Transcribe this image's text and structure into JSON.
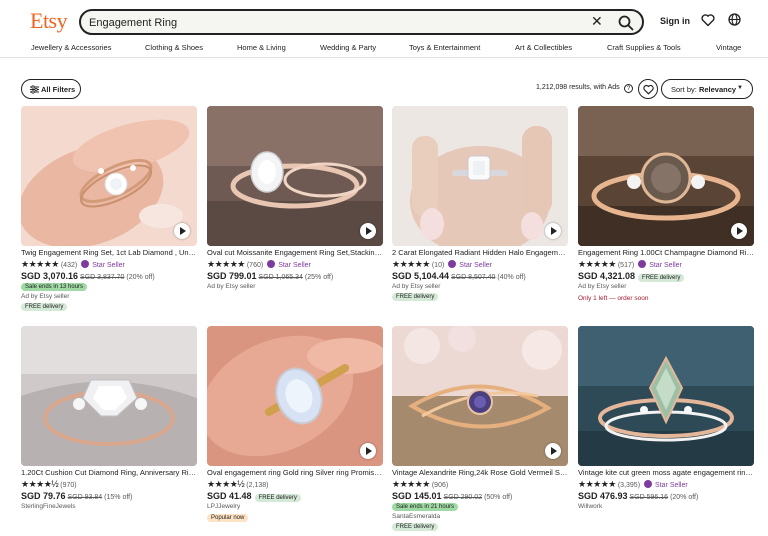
{
  "brand": {
    "logo": "Etsy",
    "accent": "#F1641E"
  },
  "search": {
    "value": "Engagement Ring",
    "clear_icon": "close-icon",
    "submit_icon": "search-icon"
  },
  "header": {
    "sign_in": "Sign in",
    "icons": [
      "heart-icon",
      "globe-icon"
    ]
  },
  "categories": [
    "Jewellery & Accessories",
    "Clothing & Shoes",
    "Home & Living",
    "Wedding & Party",
    "Toys & Entertainment",
    "Art & Collectibles",
    "Craft Supplies & Tools",
    "Vintage"
  ],
  "toolbar": {
    "filters_label": "All Filters",
    "results_text": "1,212,098 results, with Ads",
    "sort_prefix": "Sort by: ",
    "sort_value": "Relevancy"
  },
  "products": [
    {
      "title": "Twig Engagement Ring Set, 1ct Lab Diamond , Uniqu...",
      "stars": "★★★★★",
      "reviews": "(432)",
      "star_seller": "Star Seller",
      "price": "SGD 3,070.16",
      "original": "SGD 3,837.70",
      "discount": "(20% off)",
      "sale_badge": "Sale ends in 13 hours",
      "ad_line": "Ad by Etsy seller",
      "delivery": "FREE delivery",
      "video": true
    },
    {
      "title": "Oval cut Moissanite Engagement Ring Set,Stacking Ri...",
      "stars": "★★★★★",
      "reviews": "(760)",
      "star_seller": "Star Seller",
      "price": "SGD 799.01",
      "original": "SGD 1,065.34",
      "discount": "(25% off)",
      "ad_line": "Ad by Etsy seller",
      "video": true
    },
    {
      "title": "2 Carat Elongated Radiant Hidden Halo Engagement...",
      "stars": "★★★★★",
      "reviews": "(10)",
      "star_seller": "Star Seller",
      "price": "SGD 5,104.44",
      "original": "SGD 8,507.40",
      "discount": "(40% off)",
      "ad_line": "Ad by Etsy seller",
      "delivery": "FREE delivery",
      "video": true
    },
    {
      "title": "Engagement Ring 1.00Ct Champagne Diamond Ring,...",
      "stars": "★★★★★",
      "reviews": "(517)",
      "star_seller": "Star Seller",
      "price": "SGD 4,321.08",
      "price_badge": "FREE delivery",
      "ad_line": "Ad by Etsy seller",
      "stock_line": "Only 1 left — order soon",
      "video": true
    },
    {
      "title": "1.20Ct Cushion Cut Diamond Ring, Anniversary Ring, ...",
      "stars": "★★★★½",
      "reviews": "(970)",
      "price": "SGD 79.76",
      "original": "SGD 93.84",
      "discount": "(15% off)",
      "shop_line": "SterlingFineJewels",
      "video": false
    },
    {
      "title": "Oval engagement ring Gold ring Silver ring Promise ri...",
      "stars": "★★★★½",
      "reviews": "(2,138)",
      "price": "SGD 41.48",
      "price_badge": "FREE delivery",
      "shop_line": "LPJJewelry",
      "popular": "Popular now",
      "video": true
    },
    {
      "title": "Vintage Alexandrite Ring,24k Rose Gold Vermeil Silve...",
      "stars": "★★★★★",
      "reviews": "(906)",
      "price": "SGD 145.01",
      "original": "SGD 290.02",
      "discount": "(50% off)",
      "sale_badge": "Sale ends in 21 hours",
      "shop_line": "SantaEsmeralda",
      "delivery": "FREE delivery",
      "video": true
    },
    {
      "title": "Vintage kite cut green moss agate engagement ring s...",
      "stars": "★★★★★",
      "reviews": "(3,395)",
      "star_seller": "Star Seller",
      "price": "SGD 476.93",
      "original": "SGD 596.16",
      "discount": "(20% off)",
      "shop_line": "Willwork",
      "video": false
    }
  ]
}
